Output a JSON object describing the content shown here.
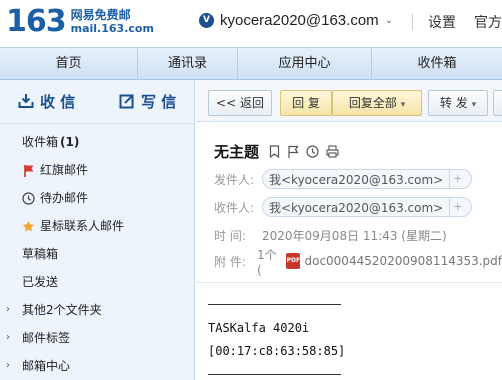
{
  "header": {
    "logo_number": "163",
    "logo_cn": "网易免费邮",
    "logo_domain": "mail.163.com",
    "account_email": "kyocera2020@163.com",
    "account_caret": "⌄",
    "settings": "设置",
    "more": "官方"
  },
  "nav": {
    "tabs": [
      "首页",
      "通讯录",
      "应用中心",
      "收件箱"
    ]
  },
  "sidebar": {
    "receive_label": "收 信",
    "compose_label": "写 信",
    "items": [
      {
        "label": "收件箱",
        "count": "(1)"
      },
      {
        "label": "红旗邮件"
      },
      {
        "label": "待办邮件"
      },
      {
        "label": "星标联系人邮件"
      },
      {
        "label": "草稿箱"
      },
      {
        "label": "已发送"
      },
      {
        "label": "其他2个文件夹"
      },
      {
        "label": "邮件标签"
      },
      {
        "label": "邮箱中心"
      }
    ]
  },
  "toolbar": {
    "back_label": "<< 返回",
    "reply_label": "回 复",
    "reply_all_label": "回复全部",
    "reply_all_caret": "▾",
    "forward_label": "转 发",
    "forward_caret": "▾"
  },
  "message": {
    "subject": "无主题",
    "from_label": "发件人:",
    "from_value": "我<kyocera2020@163.com>",
    "to_label": "收件人:",
    "to_value": "我<kyocera2020@163.com>",
    "time_label": "时  间:",
    "time_value": "2020年09月08日 11:43 (星期二)",
    "attach_label": "附  件:",
    "attach_count": "1个 (",
    "attach_type": "PDF",
    "attach_name": "doc00044520200908114353.pdf",
    "body": {
      "line1": "TASKalfa 4020i",
      "line2": "[00:17:c8:63:58:85]"
    }
  }
}
